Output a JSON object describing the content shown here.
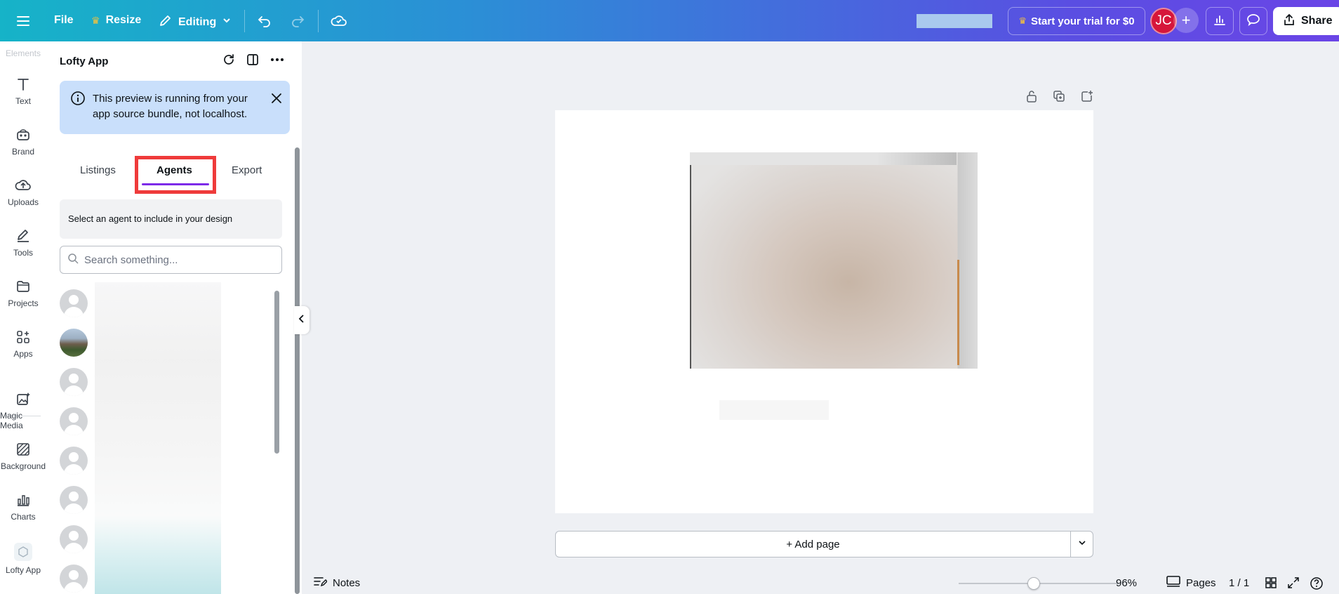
{
  "topbar": {
    "file": "File",
    "resize": "Resize",
    "editing": "Editing",
    "trial": "Start your trial for $0",
    "avatar_initials": "JC",
    "share": "Share"
  },
  "rail": {
    "faded_label": "Elements",
    "items": [
      {
        "label": "Text",
        "icon": "text-icon"
      },
      {
        "label": "Brand",
        "icon": "brand-icon"
      },
      {
        "label": "Uploads",
        "icon": "cloud-upload-icon"
      },
      {
        "label": "Tools",
        "icon": "pen-icon"
      },
      {
        "label": "Projects",
        "icon": "folder-icon"
      },
      {
        "label": "Apps",
        "icon": "apps-grid-icon"
      },
      {
        "label": "Magic Media",
        "icon": "magic-media-icon"
      },
      {
        "label": "Background",
        "icon": "background-icon"
      },
      {
        "label": "Charts",
        "icon": "chart-icon"
      },
      {
        "label": "Lofty App",
        "icon": "lofty-app-icon"
      }
    ]
  },
  "panel": {
    "title": "Lofty App",
    "notice": "This preview is running from your app source bundle, not localhost.",
    "tabs": [
      {
        "label": "Listings",
        "active": false
      },
      {
        "label": "Agents",
        "active": true
      },
      {
        "label": "Export",
        "active": false
      }
    ],
    "instruction": "Select an agent to include in your design",
    "search_placeholder": "Search something..."
  },
  "canvas": {
    "add_page": "+ Add page"
  },
  "bottombar": {
    "notes": "Notes",
    "zoom": "96%",
    "zoom_fraction": 0.47,
    "pages": "Pages",
    "page_count": "1 / 1"
  },
  "colors": {
    "accent_purple": "#7d2ae8",
    "highlight_red": "#ef3b3b",
    "notice_bg": "#c9dffb",
    "avatar_red": "#d6163b"
  }
}
